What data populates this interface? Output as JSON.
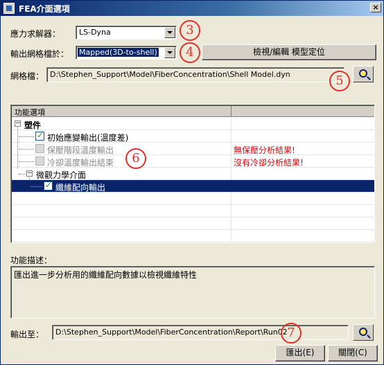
{
  "window": {
    "title": "FEA介面選項",
    "close_label": "×"
  },
  "solver": {
    "label": "應力求解器：",
    "value": "LS-Dyna"
  },
  "export_mesh": {
    "label": "輸出網格檔於：",
    "value": "Mapped(3D-to-shell)",
    "button_label": "檢視/編輯 模型定位"
  },
  "mesh_file": {
    "label": "網格檔：",
    "value": "D:\\Stephen_Support\\Model\\FiberConcentration\\Shell Model.dyn"
  },
  "tree": {
    "header": "功能選項",
    "rows": [
      {
        "label": "塑件",
        "note": ""
      },
      {
        "label": "初始應變輸出(溫度差)",
        "note": ""
      },
      {
        "label": "保壓階段溫度輸出",
        "note": "無保壓分析結果!"
      },
      {
        "label": "冷卻溫度輸出結束",
        "note": "沒有冷卻分析結果!"
      },
      {
        "label": "微觀力學介面",
        "note": ""
      },
      {
        "label": "纖維配向輸出",
        "note": ""
      }
    ]
  },
  "description": {
    "label": "功能描述：",
    "text": "匯出進一步分析用的纖維配向數據以檢視纖維特性"
  },
  "output": {
    "label": "輸出至：",
    "value": "D:\\Stephen_Support\\Model\\FiberConcentration\\Report\\Run02"
  },
  "buttons": {
    "export": "匯出(E)",
    "close": "關閉(C)"
  },
  "annotations": [
    "3",
    "4",
    "5",
    "6",
    "7"
  ]
}
